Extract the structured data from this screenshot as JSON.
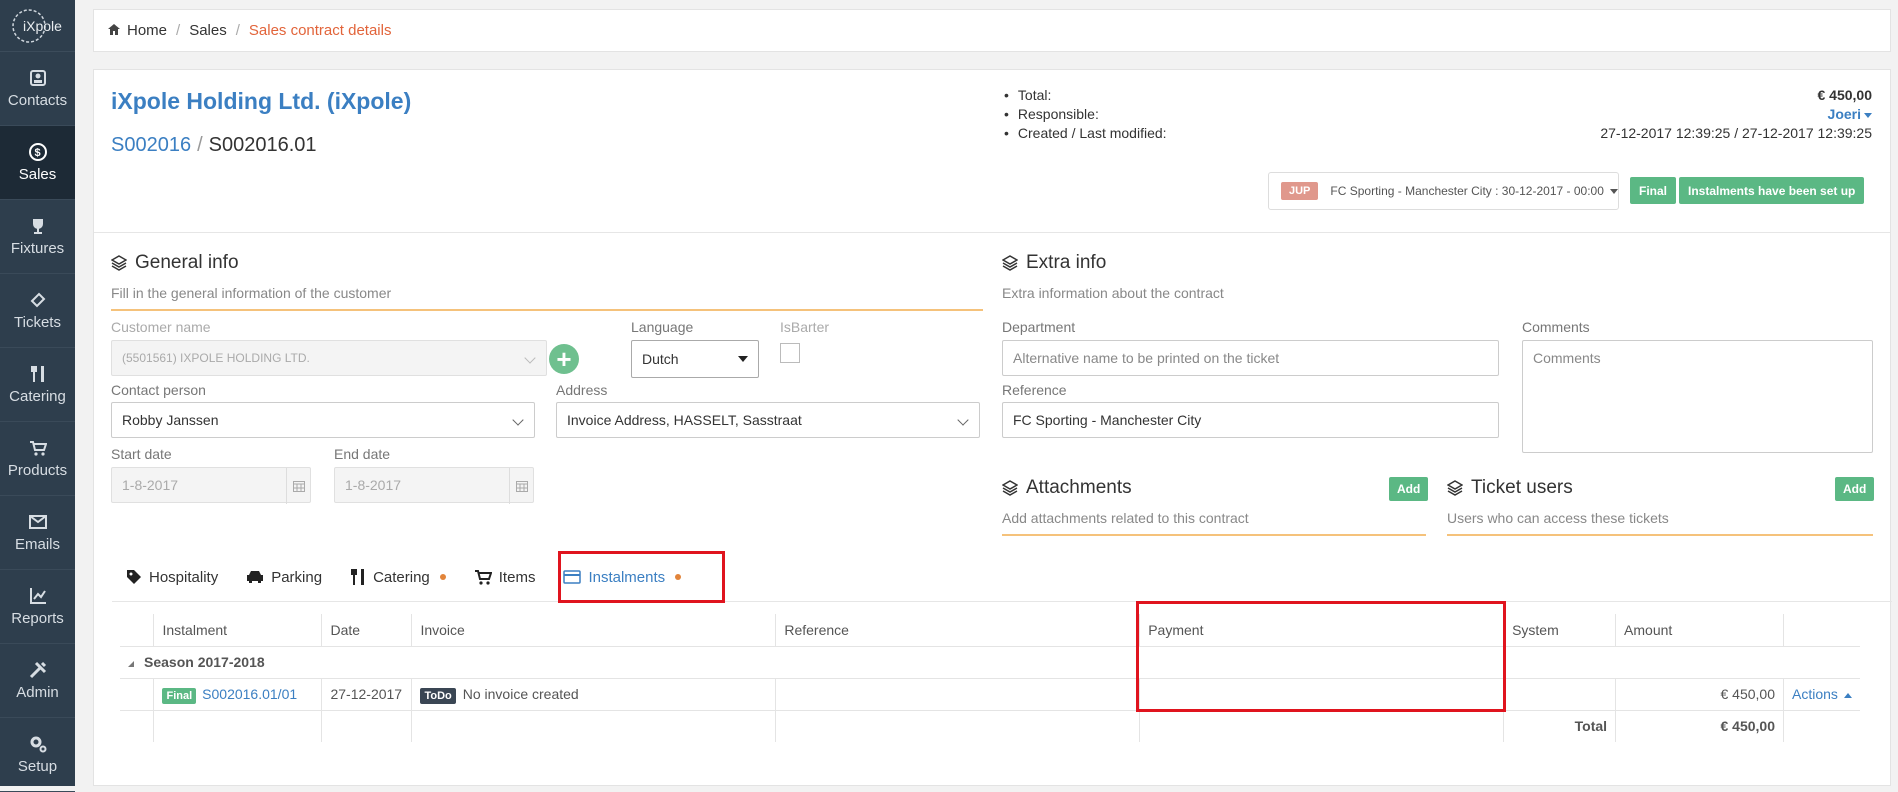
{
  "sidebar": {
    "logo_text": "iXpole",
    "items": [
      {
        "label": "Contacts",
        "icon": "contacts-icon"
      },
      {
        "label": "Sales",
        "icon": "sales-icon",
        "active": true
      },
      {
        "label": "Fixtures",
        "icon": "trophy-icon"
      },
      {
        "label": "Tickets",
        "icon": "ticket-icon"
      },
      {
        "label": "Catering",
        "icon": "cutlery-icon"
      },
      {
        "label": "Products",
        "icon": "cart-icon"
      },
      {
        "label": "Emails",
        "icon": "envelope-icon"
      },
      {
        "label": "Reports",
        "icon": "chart-icon"
      },
      {
        "label": "Admin",
        "icon": "tools-icon"
      },
      {
        "label": "Setup",
        "icon": "gears-icon"
      }
    ]
  },
  "breadcrumb": {
    "home": "Home",
    "sales": "Sales",
    "current": "Sales contract details"
  },
  "header": {
    "title": "iXpole Holding Ltd. (iXpole)",
    "contract_code": "S002016",
    "sub_code": "S002016.01",
    "total_label": "Total:",
    "total_value": "€ 450,00",
    "responsible_label": "Responsible:",
    "responsible_value": "Joeri",
    "created_label": "Created / Last modified:",
    "created_value": "27-12-2017 12:39:25 / 27-12-2017 12:39:25",
    "event_badge": "JUP",
    "event_text": "FC Sporting - Manchester City : 30-12-2017 - 00:00",
    "status_final": "Final",
    "status_instalments": "Instalments have been set up"
  },
  "general": {
    "title": "General info",
    "desc": "Fill in the general information of the customer",
    "customer_label": "Customer name",
    "customer_value": "(5501561) IXPOLE HOLDING LTD.",
    "language_label": "Language",
    "language_value": "Dutch",
    "isbarter_label": "IsBarter",
    "contact_label": "Contact person",
    "contact_value": "Robby Janssen",
    "address_label": "Address",
    "address_value": "Invoice Address, HASSELT, Sasstraat",
    "start_label": "Start date",
    "start_value": "1-8-2017",
    "end_label": "End date",
    "end_value": "1-8-2017"
  },
  "extra": {
    "title": "Extra info",
    "desc": "Extra information about the contract",
    "department_label": "Department",
    "department_placeholder": "Alternative name to be printed on the ticket",
    "comments_label": "Comments",
    "comments_placeholder": "Comments",
    "reference_label": "Reference",
    "reference_value": "FC Sporting - Manchester City"
  },
  "attachments": {
    "title": "Attachments",
    "desc": "Add attachments related to this contract",
    "add": "Add"
  },
  "ticket_users": {
    "title": "Ticket users",
    "desc": "Users who can access these tickets",
    "add": "Add"
  },
  "tabs": [
    {
      "label": "Hospitality",
      "icon": "tag-icon"
    },
    {
      "label": "Parking",
      "icon": "car-icon"
    },
    {
      "label": "Catering",
      "icon": "cutlery-icon",
      "dot": true
    },
    {
      "label": "Items",
      "icon": "cart-icon"
    },
    {
      "label": "Instalments",
      "icon": "credit-card-icon",
      "dot": true,
      "active": true
    }
  ],
  "grid": {
    "columns": [
      "Instalment",
      "Date",
      "Invoice",
      "Reference",
      "Payment",
      "System",
      "Amount",
      ""
    ],
    "group": "Season 2017-2018",
    "row": {
      "status": "Final",
      "instalment": "S002016.01/01",
      "date": "27-12-2017",
      "invoice_badge": "ToDo",
      "invoice_text": "No invoice created",
      "reference": "",
      "payment": "",
      "system": "",
      "amount": "€ 450,00",
      "actions": "Actions"
    },
    "total_label": "Total",
    "total_value": "€ 450,00"
  },
  "colors": {
    "accent_blue": "#3b7fc2",
    "brand_orange": "#e2643a",
    "green": "#5bb884",
    "highlight_red": "#e0141e",
    "sidebar": "#2e3e4d"
  }
}
